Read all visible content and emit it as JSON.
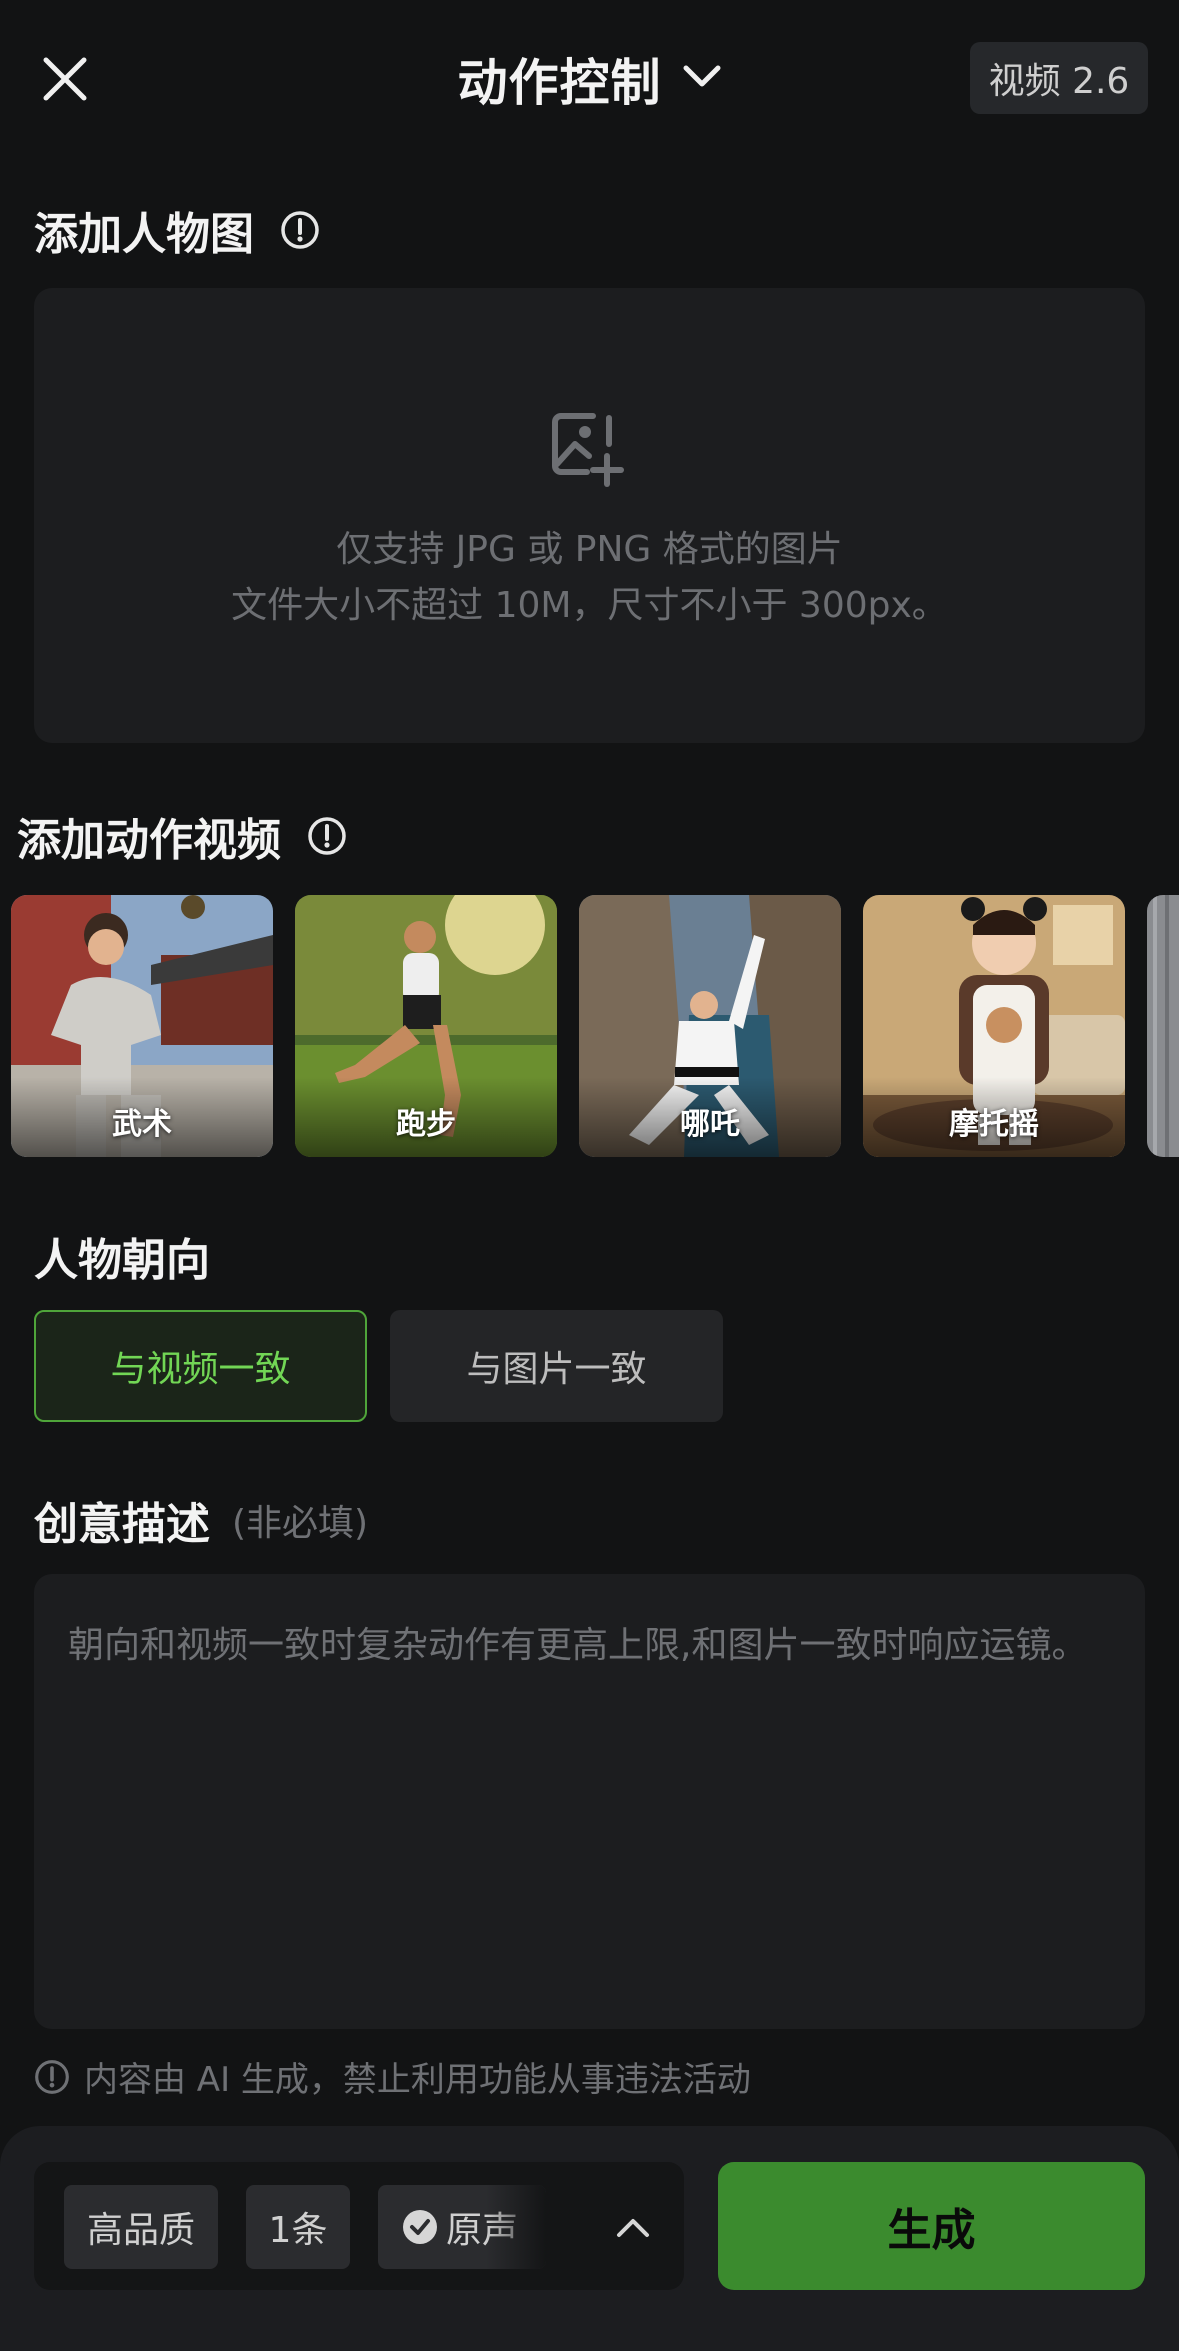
{
  "header": {
    "title": "动作控制",
    "version": "视频 2.6"
  },
  "character_image": {
    "title": "添加人物图",
    "hint_line1": "仅支持 JPG 或 PNG 格式的图片",
    "hint_line2": "文件大小不超过 10M，尺寸不小于 300px。"
  },
  "motion_video": {
    "title": "添加动作视频",
    "items": [
      {
        "label": "武术"
      },
      {
        "label": "跑步"
      },
      {
        "label": "哪吒"
      },
      {
        "label": "摩托摇"
      }
    ]
  },
  "orientation": {
    "title": "人物朝向",
    "options": [
      {
        "label": "与视频一致",
        "selected": true
      },
      {
        "label": "与图片一致",
        "selected": false
      }
    ]
  },
  "description": {
    "title": "创意描述",
    "optional_note": "(非必填)",
    "placeholder": "朝向和视频一致时复杂动作有更高上限,和图片一致时响应运镜。"
  },
  "disclaimer": "内容由 AI 生成，禁止利用功能从事违法活动",
  "bottom_bar": {
    "quality": "高品质",
    "count": "1条",
    "sound": "原声",
    "generate": "生成"
  },
  "colors": {
    "accent_green": "#3b8b2e",
    "selected_text": "#72d655",
    "background": "#121314"
  }
}
